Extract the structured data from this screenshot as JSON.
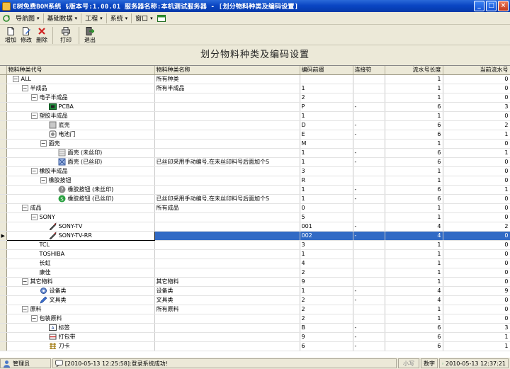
{
  "window": {
    "title": "E树免费BOM系统  §版本号:1.00.01  服务器名称:本机测试服务器 - [划分物料种类及编码设置]",
    "buttons": [
      "_",
      "□",
      "×"
    ]
  },
  "menubar": {
    "items": [
      {
        "label": "导航图",
        "caret": "▾"
      },
      {
        "label": "基础数据",
        "caret": "▾"
      },
      {
        "label": "工程",
        "caret": "▾"
      },
      {
        "label": "系统",
        "caret": "▾"
      },
      {
        "label": "窗口",
        "caret": "▾"
      }
    ]
  },
  "toolbar": {
    "add": "增加",
    "edit": "修改",
    "delete": "删除",
    "print": "打印",
    "exit": "退出"
  },
  "panel": {
    "title": "划分物料种类及编码设置"
  },
  "grid": {
    "columns": [
      "物料种类代号",
      "物料种类名称",
      "编码前缀",
      "连接符",
      "流水号长度",
      "当前流水号"
    ],
    "rows": [
      {
        "level": 0,
        "exp": "−",
        "icon": "",
        "code": "ALL",
        "name": "所有种类",
        "prefix": "",
        "sep": "",
        "len": "1",
        "cur": "0"
      },
      {
        "level": 1,
        "exp": "−",
        "icon": "",
        "code": "半成品",
        "name": "所有半成品",
        "prefix": "1",
        "sep": "",
        "len": "1",
        "cur": "0"
      },
      {
        "level": 2,
        "exp": "−",
        "icon": "",
        "code": "电子半成品",
        "name": "",
        "prefix": "2",
        "sep": "",
        "len": "1",
        "cur": "0"
      },
      {
        "level": 3,
        "exp": "",
        "icon": "pcb-icon",
        "code": "PCBA",
        "name": "",
        "prefix": "P",
        "sep": "-",
        "len": "6",
        "cur": "3"
      },
      {
        "level": 2,
        "exp": "−",
        "icon": "",
        "code": "塑胶半成品",
        "name": "",
        "prefix": "1",
        "sep": "",
        "len": "1",
        "cur": "0"
      },
      {
        "level": 3,
        "exp": "",
        "icon": "box-icon",
        "code": "底壳",
        "name": "",
        "prefix": "D",
        "sep": "-",
        "len": "6",
        "cur": "2"
      },
      {
        "level": 3,
        "exp": "",
        "icon": "battery-door-icon",
        "code": "电池门",
        "name": "",
        "prefix": "E",
        "sep": "-",
        "len": "6",
        "cur": "1"
      },
      {
        "level": 3,
        "exp": "−",
        "icon": "",
        "code": "面壳",
        "name": "",
        "prefix": "M",
        "sep": "",
        "len": "1",
        "cur": "0"
      },
      {
        "level": 4,
        "exp": "",
        "icon": "shell-icon",
        "code": "面壳 (未丝印)",
        "name": "",
        "prefix": "1",
        "sep": "-",
        "len": "6",
        "cur": "1"
      },
      {
        "level": 4,
        "exp": "",
        "icon": "shell-printed-icon",
        "code": "面壳 (已丝印)",
        "name": "已丝印采用手动编号,在未丝印料号后面加个S",
        "prefix": "1",
        "sep": "-",
        "len": "6",
        "cur": "0"
      },
      {
        "level": 2,
        "exp": "−",
        "icon": "",
        "code": "橡胶半成品",
        "name": "",
        "prefix": "3",
        "sep": "",
        "len": "1",
        "cur": "0"
      },
      {
        "level": 3,
        "exp": "−",
        "icon": "",
        "code": "橡胶按钮",
        "name": "",
        "prefix": "R",
        "sep": "",
        "len": "1",
        "cur": "0"
      },
      {
        "level": 4,
        "exp": "",
        "icon": "button-unprinted-icon",
        "code": "橡胶按钮 (未丝印)",
        "name": "",
        "prefix": "1",
        "sep": "-",
        "len": "6",
        "cur": "1"
      },
      {
        "level": 4,
        "exp": "",
        "icon": "button-printed-icon",
        "code": "橡胶按钮 (已丝印)",
        "name": "已丝印采用手动编号,在未丝印料号后面加个S",
        "prefix": "1",
        "sep": "-",
        "len": "6",
        "cur": "0"
      },
      {
        "level": 1,
        "exp": "−",
        "icon": "",
        "code": "成品",
        "name": "所有成品",
        "prefix": "0",
        "sep": "",
        "len": "1",
        "cur": "0"
      },
      {
        "level": 2,
        "exp": "−",
        "icon": "",
        "code": "SONY",
        "name": "",
        "prefix": "5",
        "sep": "",
        "len": "1",
        "cur": "0"
      },
      {
        "level": 3,
        "exp": "",
        "icon": "remote-icon",
        "code": "SONY-TV",
        "name": "",
        "prefix": "001",
        "sep": "-",
        "len": "4",
        "cur": "2"
      },
      {
        "level": 3,
        "exp": "",
        "icon": "remote-icon",
        "code": "SONY-TV-RR",
        "name": "",
        "prefix": "002",
        "sep": "-",
        "len": "4",
        "cur": "0",
        "selected": true
      },
      {
        "level": 2,
        "exp": "",
        "icon": "",
        "code": "TCL",
        "name": "",
        "prefix": "3",
        "sep": "",
        "len": "1",
        "cur": "0"
      },
      {
        "level": 2,
        "exp": "",
        "icon": "",
        "code": "TOSHIBA",
        "name": "",
        "prefix": "1",
        "sep": "",
        "len": "1",
        "cur": "0"
      },
      {
        "level": 2,
        "exp": "",
        "icon": "",
        "code": "长虹",
        "name": "",
        "prefix": "4",
        "sep": "",
        "len": "1",
        "cur": "0"
      },
      {
        "level": 2,
        "exp": "",
        "icon": "",
        "code": "康佳",
        "name": "",
        "prefix": "2",
        "sep": "",
        "len": "1",
        "cur": "0"
      },
      {
        "level": 1,
        "exp": "−",
        "icon": "",
        "code": "其它物料",
        "name": "其它物料",
        "prefix": "9",
        "sep": "",
        "len": "1",
        "cur": "0"
      },
      {
        "level": 2,
        "exp": "",
        "icon": "equipment-icon",
        "code": "设备类",
        "name": "设备类",
        "prefix": "1",
        "sep": "-",
        "len": "4",
        "cur": "9"
      },
      {
        "level": 2,
        "exp": "",
        "icon": "stationery-icon",
        "code": "文具类",
        "name": "文具类",
        "prefix": "2",
        "sep": "-",
        "len": "4",
        "cur": "0"
      },
      {
        "level": 1,
        "exp": "−",
        "icon": "",
        "code": "原料",
        "name": "所有原料",
        "prefix": "2",
        "sep": "",
        "len": "1",
        "cur": "0"
      },
      {
        "level": 2,
        "exp": "−",
        "icon": "",
        "code": "包装原料",
        "name": "",
        "prefix": "2",
        "sep": "",
        "len": "1",
        "cur": "0"
      },
      {
        "level": 3,
        "exp": "",
        "icon": "label-icon",
        "code": "标签",
        "name": "",
        "prefix": "B",
        "sep": "-",
        "len": "6",
        "cur": "3"
      },
      {
        "level": 3,
        "exp": "",
        "icon": "strap-icon",
        "code": "打包带",
        "name": "",
        "prefix": "9",
        "sep": "-",
        "len": "6",
        "cur": "1"
      },
      {
        "level": 3,
        "exp": "",
        "icon": "card-icon",
        "code": "刀卡",
        "name": "",
        "prefix": "6",
        "sep": "-",
        "len": "6",
        "cur": "1"
      }
    ]
  },
  "statusbar": {
    "user": "管理员",
    "message": "[2010-05-13 12:25:58]:登录系统成功!",
    "caps": "小写",
    "num": "数字",
    "datetime": "2010-05-13  12:37:21"
  }
}
